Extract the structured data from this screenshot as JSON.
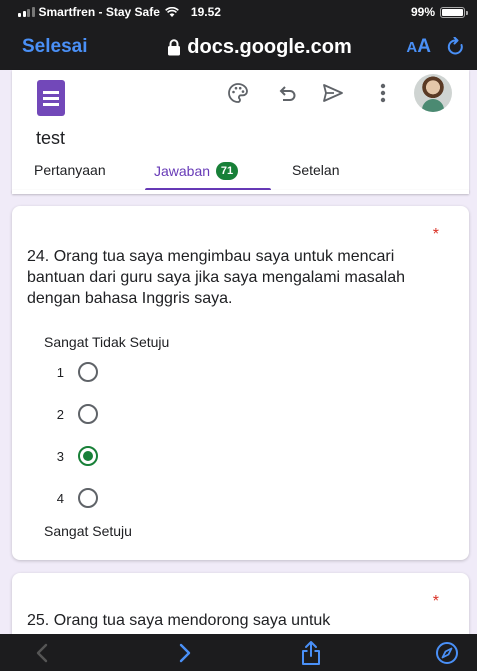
{
  "status_bar": {
    "carrier": "Smartfren - Stay Safe",
    "time": "19.52",
    "battery": "99%"
  },
  "browser": {
    "done_label": "Selesai",
    "url": "docs.google.com",
    "text_size_small": "A",
    "text_size_big": "A"
  },
  "form": {
    "title": "test",
    "tabs": [
      {
        "label": "Pertanyaan"
      },
      {
        "label": "Jawaban",
        "badge": "71"
      },
      {
        "label": "Setelan"
      }
    ]
  },
  "questions": [
    {
      "text": "24. Orang tua saya mengimbau saya untuk mencari bantuan dari guru saya jika saya mengalami masalah dengan bahasa Inggris saya.",
      "required_mark": "*",
      "low_label": "Sangat Tidak Setuju",
      "high_label": "Sangat Setuju",
      "options": [
        "1",
        "2",
        "3",
        "4"
      ],
      "selected": "3"
    },
    {
      "text": "25. Orang tua saya mendorong saya untuk",
      "required_mark": "*"
    }
  ],
  "colors": {
    "accent": "#673ab7",
    "badge": "#188038",
    "ios_blue": "#4a90f7",
    "required": "#d93025"
  },
  "icons": [
    "wifi-icon",
    "lock-icon",
    "reload-icon",
    "palette-icon",
    "undo-icon",
    "send-icon",
    "more-vert-icon",
    "back-icon",
    "forward-icon",
    "share-icon",
    "compass-icon"
  ]
}
